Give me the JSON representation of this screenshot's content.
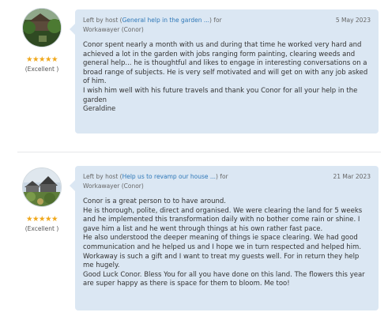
{
  "reviews": [
    {
      "rating_stars": "★★★★★",
      "rating_value": 5,
      "rating_label": "(Excellent )",
      "left_by_prefix": "Left by host (",
      "host_link": "General help in the garden ...",
      "left_by_suffix": ") for",
      "workawayer": "Workawayer (Conor)",
      "date": "5 May 2023",
      "paragraphs": [
        "Conor spent nearly a month with us and during that time he worked very hard and achieved a lot in the garden with jobs ranging form painting, clearing weeds and general help... he is thoughtful and likes to engage in interesting conversations on a broad range of subjects. He is very self motivated and will get on with any job asked of him.",
        "I wish him well with his future travels and thank you Conor for all your help in the garden",
        "Geraldine"
      ]
    },
    {
      "rating_stars": "★★★★★",
      "rating_value": 5,
      "rating_label": "(Excellent )",
      "left_by_prefix": "Left by host (",
      "host_link": "Help us to revamp our house ...",
      "left_by_suffix": ") for",
      "workawayer": "Workawayer (Conor)",
      "date": "21 Mar 2023",
      "paragraphs": [
        "Conor is a great person to to have around.",
        "He is thorough, polite, direct and organised. We were clearing the land for 5 weeks and he implemented this transformation daily with no bother come rain or shine. I gave him a list and he went through things at his own rather fast pace.",
        "He also understood the deeper meaning of things ie space clearing. We had good communication and he helped us and I hope we in turn respected and helped him. Workaway is such a gift and I want to treat my guests well. For in return they help me hugely.",
        "Good Luck Conor. Bless You for all you have done on this land. The flowers this year are super happy as there is space for them to bloom. Me too!"
      ]
    }
  ]
}
